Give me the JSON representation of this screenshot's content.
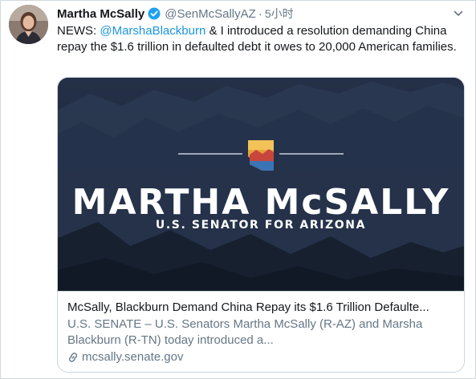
{
  "author": {
    "display_name": "Martha McSally",
    "handle": "@SenMcSallyAZ",
    "separator": "·",
    "time": "5小时"
  },
  "icons": {
    "verified": "verified-badge-icon",
    "caret": "chevron-down-icon",
    "link": "link-icon"
  },
  "tweet": {
    "prefix": "NEWS: ",
    "mention": "@MarshaBlackburn",
    "rest": " & I introduced a resolution demanding China repay the $1.6 trillion in defaulted debt it owes to 20,000 American families."
  },
  "card": {
    "image_title": "MARTHA McSALLY",
    "image_subtitle": "U.S. SENATOR FOR ARIZONA",
    "title": "McSally, Blackburn Demand China Repay its $1.6 Trillion Defaulte...",
    "description": "U.S. SENATE – U.S. Senators Martha McSally (R-AZ) and Marsha Blackburn (R-TN) today introduced a...",
    "domain": "mcsally.senate.gov"
  },
  "colors": {
    "link_blue": "#1b95e0",
    "verified_blue": "#1da1f2",
    "secondary_text": "#657786",
    "card_border": "#ccd6dd"
  }
}
